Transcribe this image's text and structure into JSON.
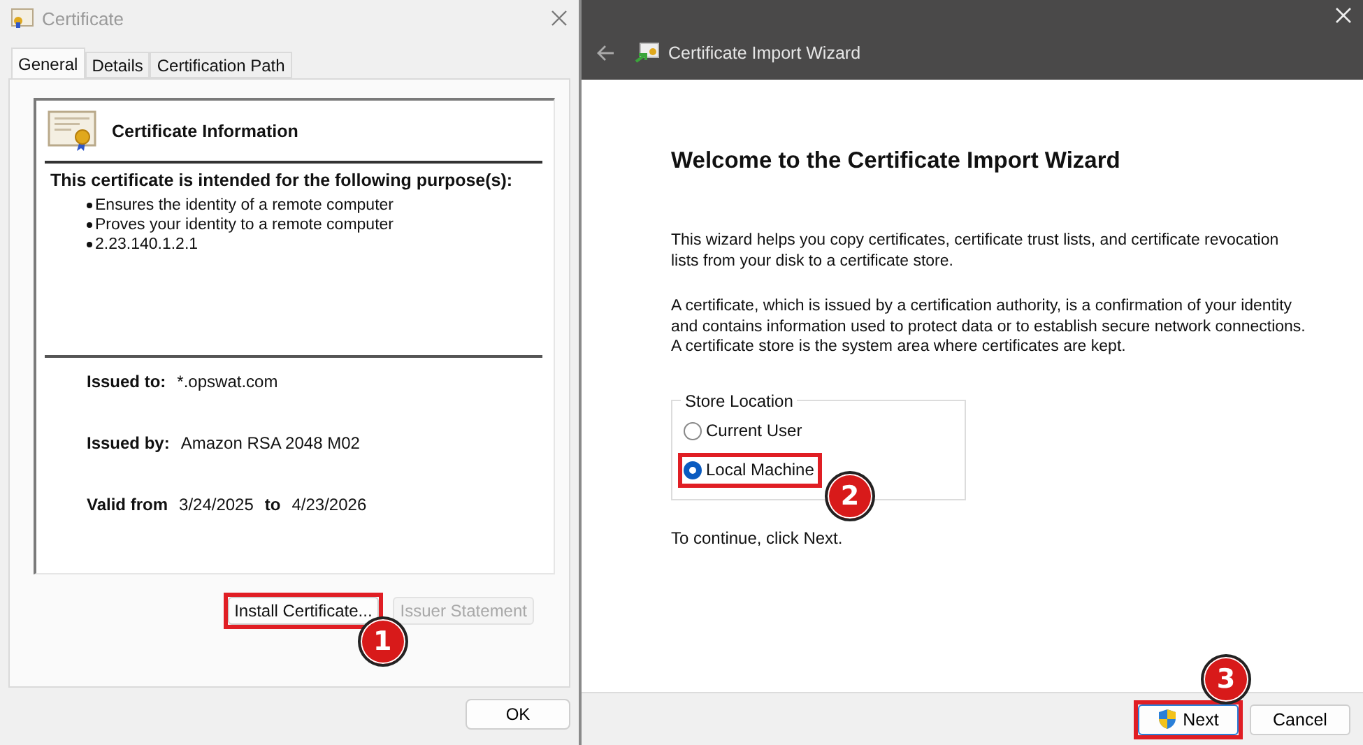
{
  "certificate_dialog": {
    "title": "Certificate",
    "tabs": [
      {
        "label": "General",
        "selected": true
      },
      {
        "label": "Details",
        "selected": false
      },
      {
        "label": "Certification Path",
        "selected": false
      }
    ],
    "header": "Certificate Information",
    "purpose_heading": "This certificate is intended for the following purpose(s):",
    "purposes": [
      "Ensures the identity of a remote computer",
      "Proves your identity to a remote computer",
      "2.23.140.1.2.1"
    ],
    "issued_to": {
      "label": "Issued to:",
      "value": "*.opswat.com"
    },
    "issued_by": {
      "label": "Issued by:",
      "value": "Amazon RSA 2048 M02"
    },
    "validity": {
      "label": "Valid from",
      "from": "3/24/2025",
      "to_label": "to",
      "to": "4/23/2026"
    },
    "buttons": [
      {
        "label": "Install Certificate...",
        "disabled": false,
        "step": "1"
      },
      {
        "label": "Issuer Statement",
        "disabled": true
      }
    ],
    "ok_button": "OK"
  },
  "import_wizard": {
    "title": "Certificate Import Wizard",
    "heading": "Welcome to the Certificate Import Wizard",
    "paragraphs": [
      "This wizard helps you copy certificates, certificate trust lists, and certificate revocation lists from your disk to a certificate store.",
      "A certificate, which is issued by a certification authority, is a confirmation of your identity and contains information used to protect data or to establish secure network connections. A certificate store is the system area where certificates are kept."
    ],
    "store_location": {
      "legend": "Store Location",
      "options": [
        {
          "label": "Current User",
          "selected": false
        },
        {
          "label": "Local Machine",
          "selected": true,
          "step": "2"
        }
      ]
    },
    "hint": "To continue, click Next.",
    "buttons": [
      {
        "label": "Next",
        "kind": "shield",
        "step": "3"
      },
      {
        "label": "Cancel",
        "kind": "plain"
      }
    ]
  }
}
